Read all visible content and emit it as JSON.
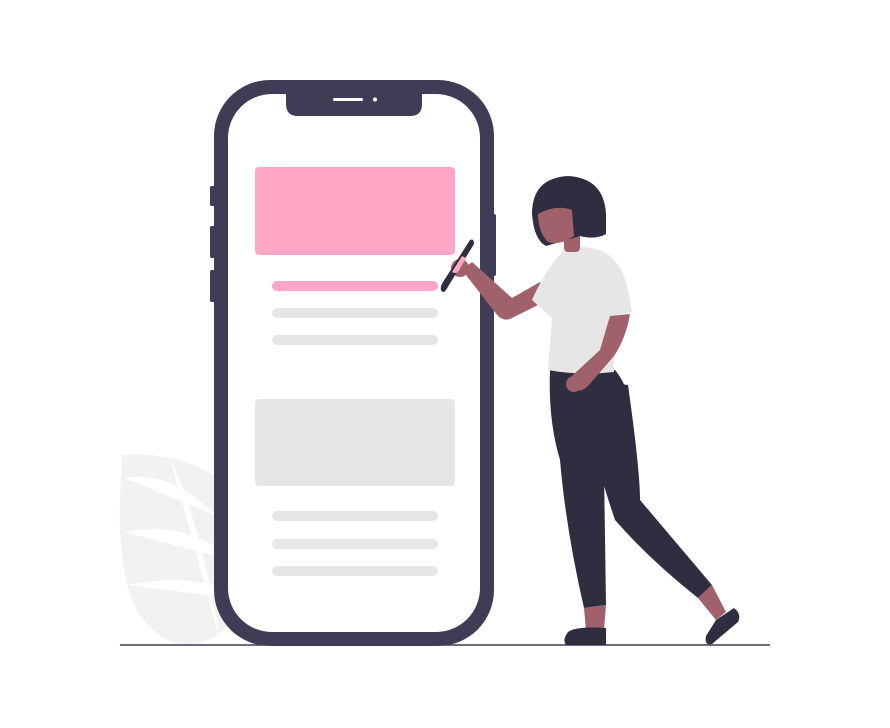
{
  "colors": {
    "background": "#ffffff",
    "phone_frame": "#3f3d56",
    "phone_screen": "#ffffff",
    "accent_pink": "#ffa5c5",
    "placeholder_gray": "#e6e6e6",
    "leaf_gray": "#f2f2f2",
    "leaf_veins": "#ffffff",
    "skin": "#a0616a",
    "hair": "#2f2e41",
    "shirt": "#e6e6e6",
    "pants": "#2f2e41",
    "shoes": "#2f2e41",
    "ground_line": "#3f3d56"
  },
  "icons": {
    "phone": "smartphone-illustration",
    "person": "woman-with-pen-illustration",
    "leaf": "decorative-leaf",
    "pen": "stylus-pen"
  }
}
